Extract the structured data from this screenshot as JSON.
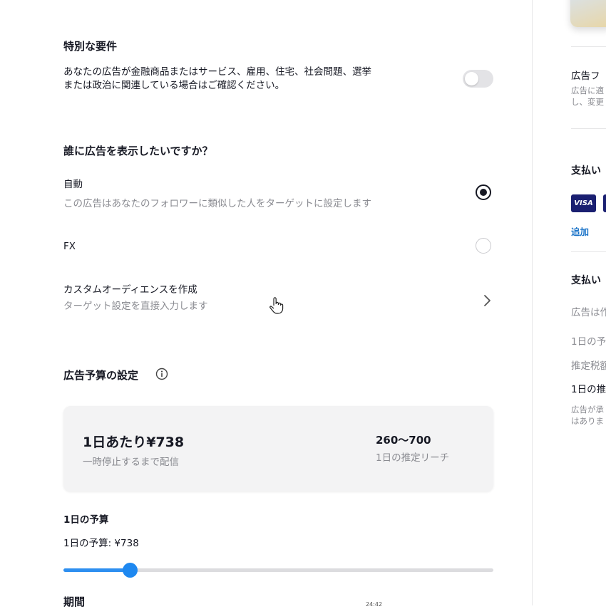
{
  "requirements": {
    "title": "特別な要件",
    "desc_line1": "あなたの広告が金融商品またはサービス、雇用、住宅、社会問題、選挙",
    "desc_line2": "または政治に関連している場合はご確認ください。",
    "toggle_on": false
  },
  "audience": {
    "title": "誰に広告を表示したいですか？",
    "options": [
      {
        "label": "自動",
        "desc": "この広告はあなたのフォロワーに類似した人をターゲットに設定します",
        "selected": true
      },
      {
        "label": "FX",
        "desc": "",
        "selected": false
      }
    ],
    "custom": {
      "label": "カスタムオーディエンスを作成",
      "desc": "ターゲット設定を直接入力します"
    }
  },
  "budget": {
    "title": "広告予算の設定",
    "card": {
      "amount": "1日あたり¥738",
      "amount_sub": "一時停止するまで配信",
      "reach": "260〜700",
      "reach_sub": "1日の推定リーチ"
    },
    "daily_label": "1日の予算",
    "daily_value_text": "1日の予算: ¥738",
    "slider_fraction": 0.155,
    "period_label": "期間",
    "time_text": "24:42"
  },
  "side": {
    "ad_label": "広告フ",
    "ad_desc_line1": "広告に適",
    "ad_desc_line2": "し、変更",
    "payment_title": "支払い",
    "visa": "VISA",
    "add_link": "追加",
    "payment_title2": "支払い",
    "ad_note": "広告は作",
    "daily_budget": "1日の予",
    "tax": "推定税額",
    "daily_total": "1日の推",
    "footnote_line1": "広告が承",
    "footnote_line2": "はありま"
  },
  "colors": {
    "accent": "#1e88f0",
    "link": "#1a73c8",
    "text": "#161823",
    "muted": "#8a8b91"
  },
  "icons": {
    "info": "info-circle-icon",
    "chevron": "chevron-right-icon",
    "cursor": "hand-pointer-icon"
  }
}
